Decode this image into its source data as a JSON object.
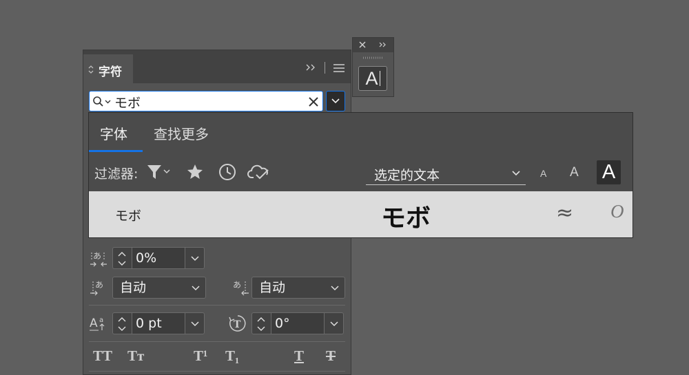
{
  "character_panel": {
    "tab_title": "字符",
    "search": {
      "value": "モボ"
    },
    "tracking": {
      "value": "0%"
    },
    "aki_left": {
      "value": "自动"
    },
    "aki_right": {
      "value": "自动"
    },
    "baseline_shift": {
      "value": "0 pt"
    },
    "character_rotation": {
      "value": "0°"
    },
    "type_buttons": [
      "TT",
      "Tт",
      "T¹",
      "T₁",
      "T",
      "T"
    ]
  },
  "mini_panel": {
    "char_button_label": "A"
  },
  "font_popup": {
    "tabs": [
      "字体",
      "查找更多"
    ],
    "filter_label": "过滤器:",
    "preview_select": "选定的文本",
    "size_labels": [
      "A",
      "A",
      "A"
    ],
    "result": {
      "font_name": "モボ",
      "sample": "モボ",
      "similar_symbol": "≈",
      "opentype_symbol": "O"
    }
  }
}
